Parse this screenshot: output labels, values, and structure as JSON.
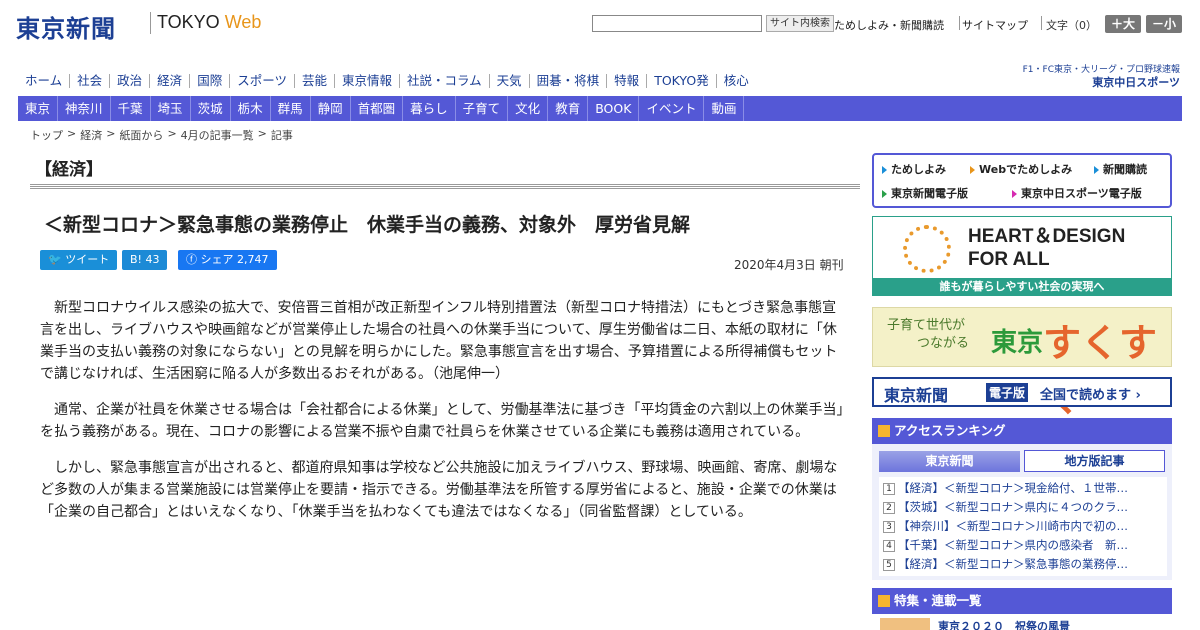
{
  "header": {
    "logo": "東京新聞",
    "logo_sub_left": "TOKYO ",
    "logo_sub_right": "Web",
    "search_button": "サイト内検索",
    "link_trial": "ためしよみ・新聞購読",
    "link_sitemap": "サイトマップ",
    "font_size_label": "文字（0）",
    "font_larger": "＋大",
    "font_smaller": "－小"
  },
  "nav_main": [
    "ホーム",
    "社会",
    "政治",
    "経済",
    "国際",
    "スポーツ",
    "芸能",
    "東京情報",
    "社説・コラム",
    "天気",
    "囲碁・将棋",
    "特報",
    "TOKYO発",
    "核心"
  ],
  "sports_logo": {
    "line1": "F1・FC東京・大リーグ・プロ野球速報",
    "line2": "東京中日スポーツ"
  },
  "nav_region": [
    "東京",
    "神奈川",
    "千葉",
    "埼玉",
    "茨城",
    "栃木",
    "群馬",
    "静岡",
    "首都圏",
    "暮らし",
    "子育て",
    "文化",
    "教育",
    "BOOK",
    "イベント",
    "動画"
  ],
  "breadcrumb": [
    "トップ",
    ">",
    "経済",
    ">",
    "紙面から",
    ">",
    "4月の記事一覧",
    ">",
    "記事"
  ],
  "article": {
    "category": "【経済】",
    "title": "＜新型コロナ＞緊急事態の業務停止　休業手当の義務、対象外　厚労省見解",
    "share_tweet": "ツイート",
    "share_hatena": "B! 43",
    "share_facebook": "シェア 2,747",
    "date": "2020年4月3日 朝刊",
    "paragraphs": [
      "新型コロナウイルス感染の拡大で、安倍晋三首相が改正新型インフル特別措置法（新型コロナ特措法）にもとづき緊急事態宣言を出し、ライブハウスや映画館などが営業停止した場合の社員への休業手当について、厚生労働省は二日、本紙の取材に「休業手当の支払い義務の対象にならない」との見解を明らかにした。緊急事態宣言を出す場合、予算措置による所得補償もセットで講じなければ、生活困窮に陥る人が多数出るおそれがある。（池尾伸一）",
      "通常、企業が社員を休業させる場合は「会社都合による休業」として、労働基準法に基づき「平均賃金の六割以上の休業手当」を払う義務がある。現在、コロナの影響による営業不振や自粛で社員らを休業させている企業にも義務は適用されている。",
      "しかし、緊急事態宣言が出されると、都道府県知事は学校など公共施設に加えライブハウス、野球場、映画館、寄席、劇場など多数の人が集まる営業施設には営業停止を要請・指示できる。労働基準法を所管する厚労省によると、施設・企業での休業は「企業の自己都合」とはいえなくなり、「休業手当を払わなくても違法ではなくなる」（同省監督課）としている。"
    ]
  },
  "sidebar": {
    "promo": {
      "trial": "ためしよみ",
      "web_trial": "Webでためしよみ",
      "subscribe": "新聞購読",
      "digital": "東京新聞電子版",
      "chunichi_digital": "東京中日スポーツ電子版"
    },
    "heart_design": {
      "line1": "HEART＆DESIGN",
      "line2": "FOR ALL",
      "caption": "誰もが暮らしやすい社会の実現へ"
    },
    "sukusuku": {
      "line1": "子育て世代が",
      "line2": "つながる",
      "brand1": "東京",
      "brand2": "すくすく"
    },
    "denshi": {
      "logo": "東京新聞",
      "badge": "電子版",
      "text": "全国で読めます ›"
    },
    "ranking": {
      "heading": "アクセスランキング",
      "tab_tokyo": "東京新聞",
      "tab_local": "地方版記事",
      "items": [
        {
          "num": "1",
          "text": "【経済】＜新型コロナ＞現金給付、１世帯…"
        },
        {
          "num": "2",
          "text": "【茨城】＜新型コロナ＞県内に４つのクラ…"
        },
        {
          "num": "3",
          "text": "【神奈川】＜新型コロナ＞川崎市内で初の…"
        },
        {
          "num": "4",
          "text": "【千葉】＜新型コロナ＞県内の感染者　新…"
        },
        {
          "num": "5",
          "text": "【経済】＜新型コロナ＞緊急事態の業務停…"
        }
      ]
    },
    "feature_heading": "特集・連載一覧",
    "feature_item": "東京２０２０　祝祭の風景"
  },
  "colors": {
    "brand_blue": "#1c3f94",
    "nav_purple": "#5458d6",
    "accent_orange": "#e8951a"
  }
}
